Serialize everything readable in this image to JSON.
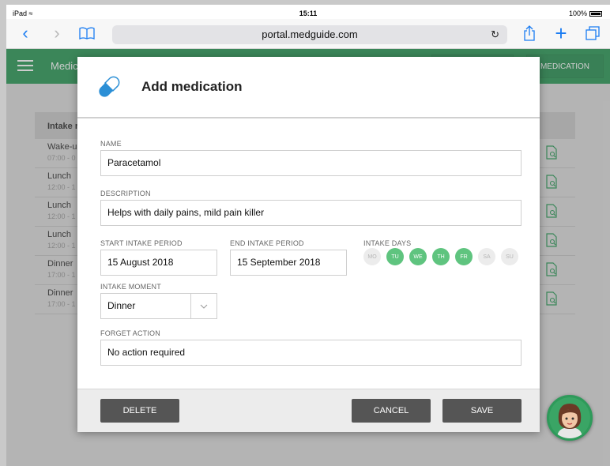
{
  "status_bar": {
    "device": "iPad",
    "time": "15:11",
    "battery": "100%"
  },
  "browser": {
    "url": "portal.medguide.com"
  },
  "app": {
    "title": "Medic",
    "header_button_right": "MEDICATION",
    "accent": "#2e9a5a"
  },
  "table": {
    "header": "Intake r",
    "rows": [
      {
        "title": "Wake-up",
        "time": "07:00 - 0"
      },
      {
        "title": "Lunch",
        "time": "12:00 - 1"
      },
      {
        "title": "Lunch",
        "time": "12:00 - 1"
      },
      {
        "title": "Lunch",
        "time": "12:00 - 1"
      },
      {
        "title": "Dinner",
        "time": "17:00 - 1"
      },
      {
        "title": "Dinner",
        "time": "17:00 - 1"
      }
    ]
  },
  "modal": {
    "title": "Add medication",
    "name_label": "NAME",
    "name_value": "Paracetamol",
    "description_label": "DESCRIPTION",
    "description_value": "Helps with daily pains, mild pain killer",
    "start_label": "START INTAKE PERIOD",
    "start_value": "15 August 2018",
    "end_label": "END INTAKE PERIOD",
    "end_value": "15 September 2018",
    "days_label": "INTAKE DAYS",
    "days": [
      {
        "label": "MO",
        "active": false
      },
      {
        "label": "TU",
        "active": true
      },
      {
        "label": "WE",
        "active": true
      },
      {
        "label": "TH",
        "active": true
      },
      {
        "label": "FR",
        "active": true
      },
      {
        "label": "SA",
        "active": false
      },
      {
        "label": "SU",
        "active": false
      }
    ],
    "moment_label": "INTAKE MOMENT",
    "moment_value": "Dinner",
    "forget_label": "FORGET ACTION",
    "forget_value": "No action required",
    "delete_label": "DELETE",
    "cancel_label": "CANCEL",
    "save_label": "SAVE"
  }
}
